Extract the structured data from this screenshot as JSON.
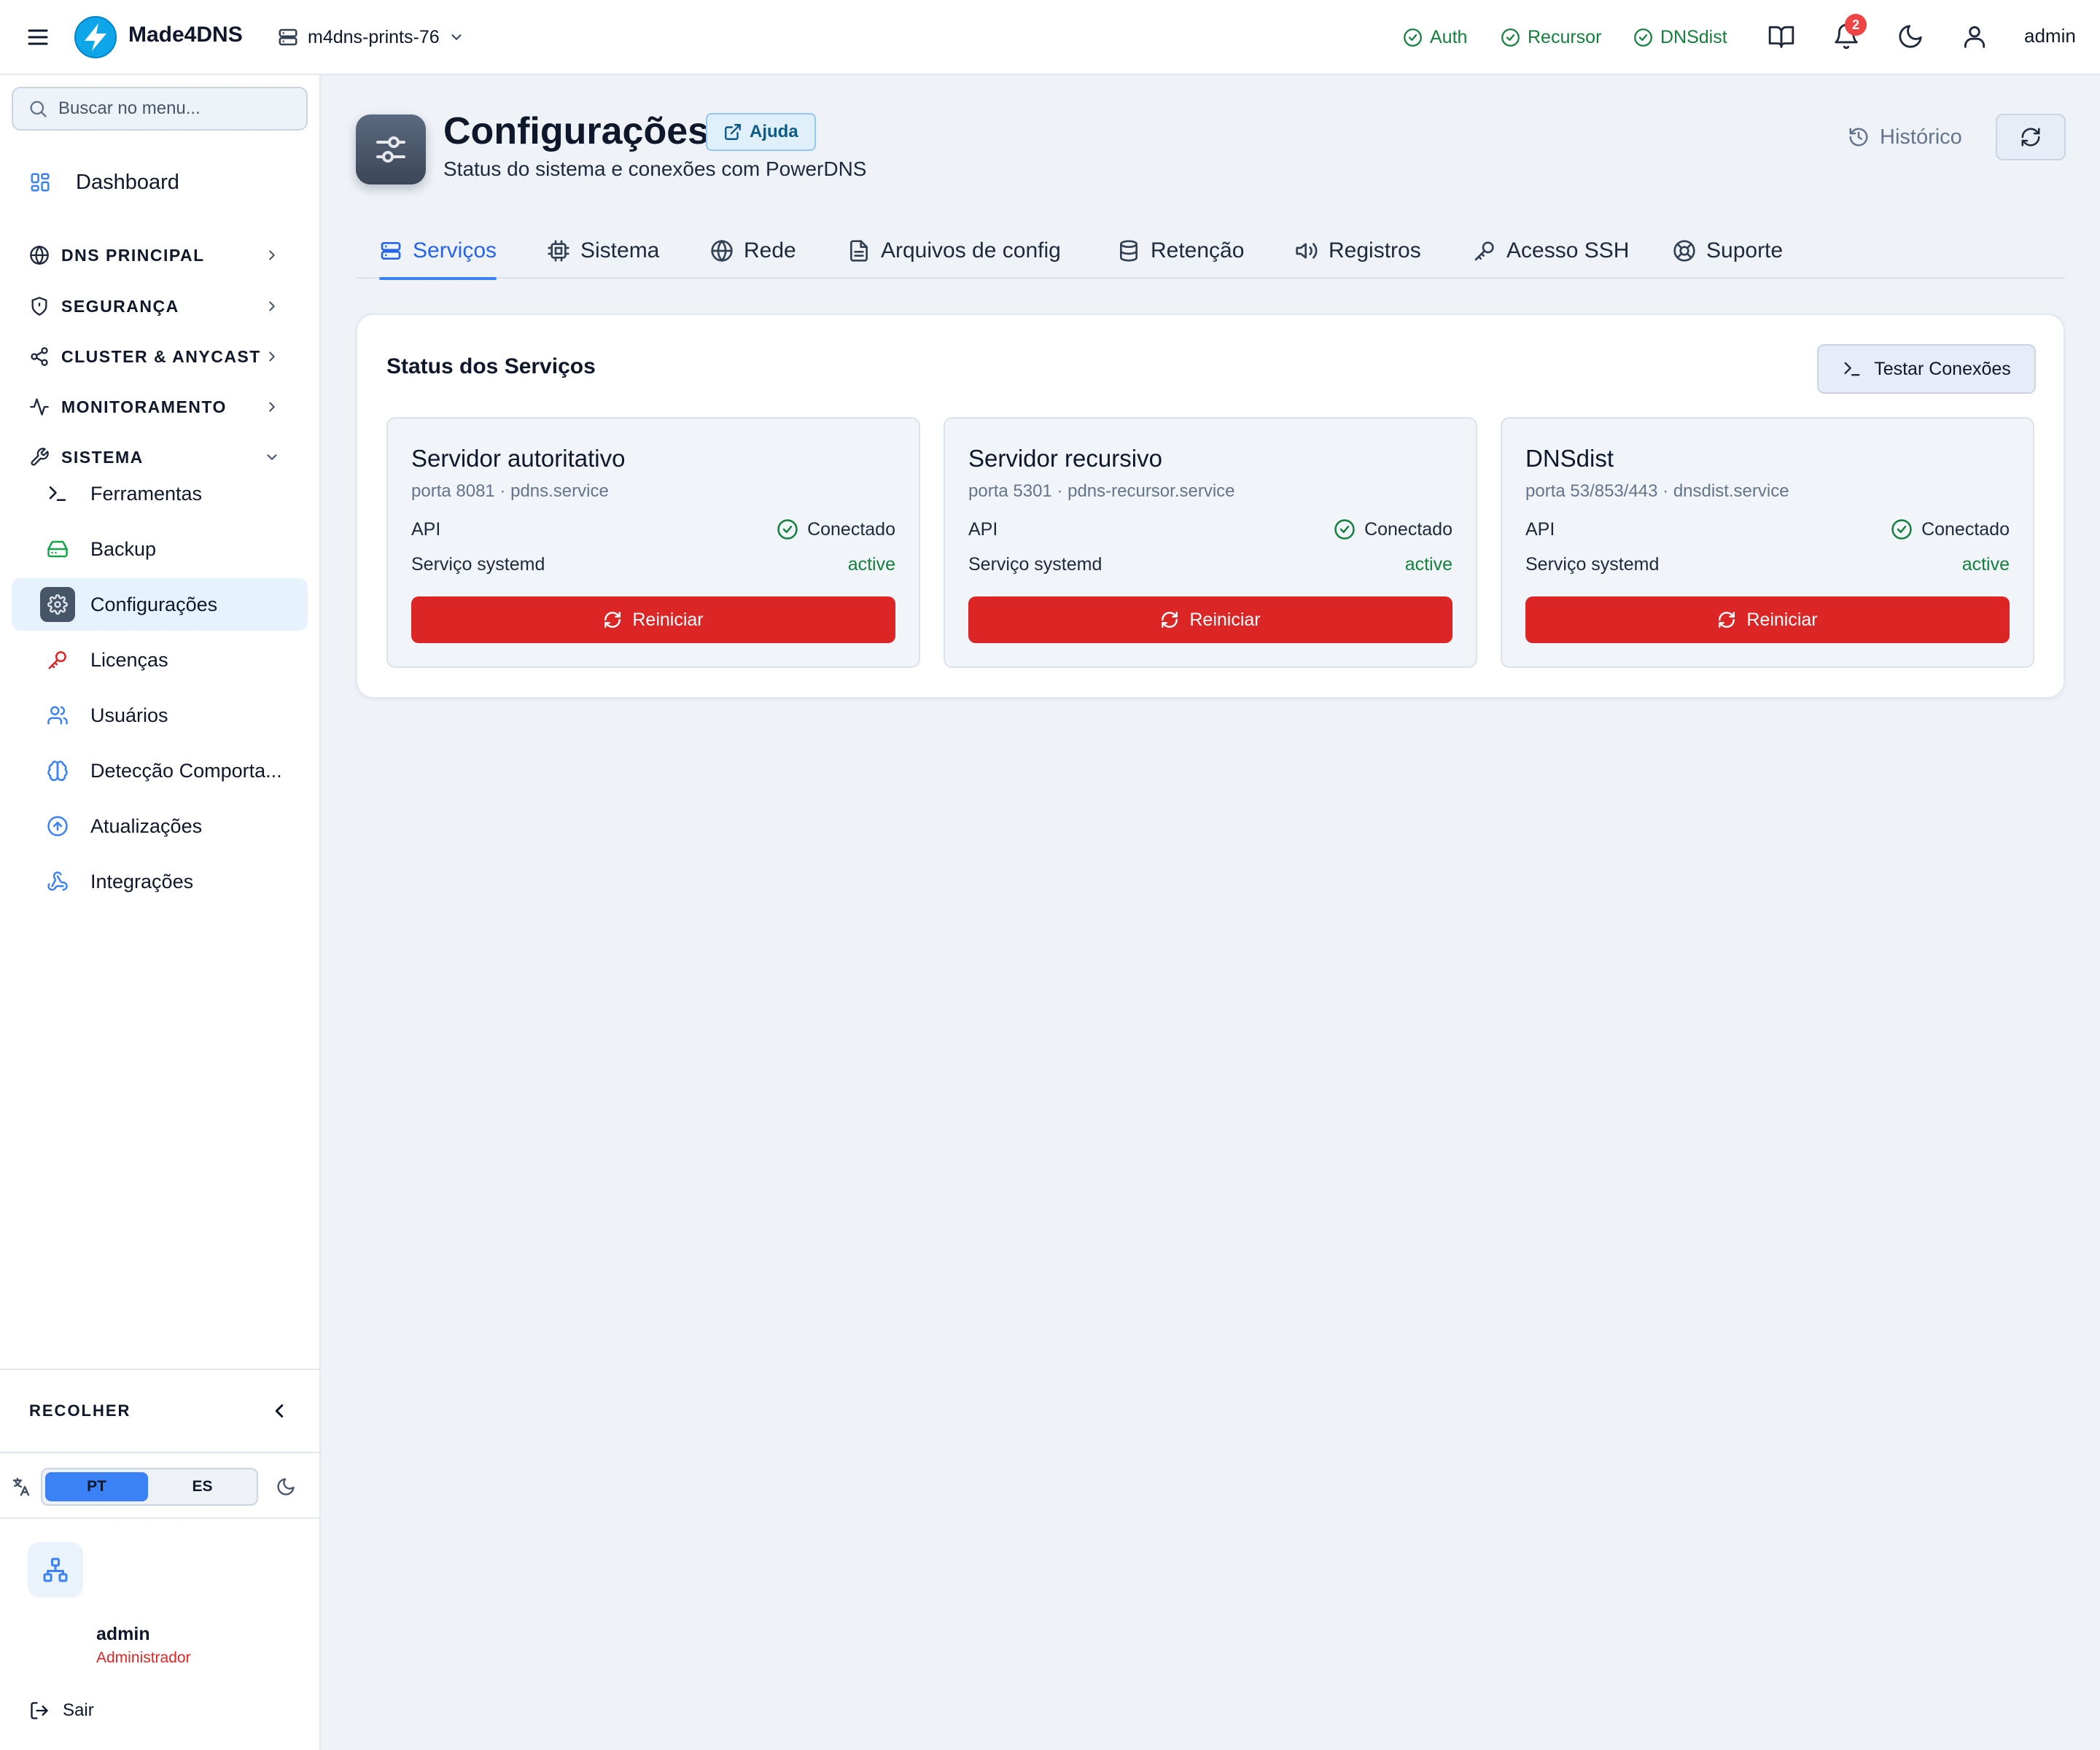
{
  "topbar": {
    "brand": "Made4DNS",
    "server": "m4dns-prints-76",
    "statuses": [
      {
        "label": "Auth",
        "icon": "check-circle-icon"
      },
      {
        "label": "Recursor",
        "icon": "check-circle-icon"
      },
      {
        "label": "DNSdist",
        "icon": "check-circle-icon"
      }
    ],
    "notification_count": "2",
    "user": "admin",
    "colors": {
      "ok": "#15803d",
      "badge": "#ef4444",
      "brand": "#0ea5e9"
    }
  },
  "sidebar": {
    "search_placeholder": "Buscar no menu...",
    "dashboard": "Dashboard",
    "sections": [
      {
        "label": "DNS PRINCIPAL",
        "icon": "globe-icon",
        "expanded": false
      },
      {
        "label": "SEGURANÇA",
        "icon": "shield-icon",
        "expanded": false
      },
      {
        "label": "CLUSTER & ANYCAST",
        "icon": "share-icon",
        "expanded": false
      },
      {
        "label": "MONITORAMENTO",
        "icon": "activity-icon",
        "expanded": false
      },
      {
        "label": "SISTEMA",
        "icon": "wrench-icon",
        "expanded": true
      }
    ],
    "sistema_items": [
      {
        "label": "Ferramentas",
        "icon": "terminal-icon",
        "color": "#0f172a"
      },
      {
        "label": "Backup",
        "icon": "hard-drive-icon",
        "color": "#16a34a"
      },
      {
        "label": "Configurações",
        "icon": "gear-icon",
        "active": true
      },
      {
        "label": "Licenças",
        "icon": "key-icon",
        "color": "#dc2626"
      },
      {
        "label": "Usuários",
        "icon": "users-icon",
        "color": "#3b82f6"
      },
      {
        "label": "Detecção Comporta...",
        "icon": "brain-icon",
        "color": "#3b82f6"
      },
      {
        "label": "Atualizações",
        "icon": "arrow-up-circle-icon",
        "color": "#3b82f6"
      },
      {
        "label": "Integrações",
        "icon": "webhook-icon",
        "color": "#3b82f6"
      }
    ],
    "collapse_label": "RECOLHER",
    "languages": [
      "PT",
      "ES"
    ],
    "selected_language": "PT",
    "profile": {
      "name": "admin",
      "role": "Administrador"
    },
    "logout": "Sair"
  },
  "page": {
    "title": "Configurações",
    "help": "Ajuda",
    "subtitle": "Status do sistema e conexões com PowerDNS",
    "history": "Histórico"
  },
  "tabs": [
    {
      "label": "Serviços",
      "icon": "server-icon",
      "active": true
    },
    {
      "label": "Sistema",
      "icon": "cpu-icon"
    },
    {
      "label": "Rede",
      "icon": "globe-icon"
    },
    {
      "label": "Arquivos de config",
      "icon": "file-icon"
    },
    {
      "label": "Retenção",
      "icon": "database-icon"
    },
    {
      "label": "Registros",
      "icon": "volume-icon"
    },
    {
      "label": "Acesso SSH",
      "icon": "key-icon"
    },
    {
      "label": "Suporte",
      "icon": "life-buoy-icon"
    }
  ],
  "services_panel": {
    "title": "Status dos Serviços",
    "test_button": "Testar Conexões",
    "cards": [
      {
        "name": "Servidor autoritativo",
        "meta": "porta 8081 · pdns.service",
        "api_label": "API",
        "api_status": "Conectado",
        "systemd_label": "Serviço systemd",
        "systemd_status": "active",
        "restart": "Reiniciar"
      },
      {
        "name": "Servidor recursivo",
        "meta": "porta 5301 · pdns-recursor.service",
        "api_label": "API",
        "api_status": "Conectado",
        "systemd_label": "Serviço systemd",
        "systemd_status": "active",
        "restart": "Reiniciar"
      },
      {
        "name": "DNSdist",
        "meta": "porta 53/853/443 · dnsdist.service",
        "api_label": "API",
        "api_status": "Conectado",
        "systemd_label": "Serviço systemd",
        "systemd_status": "active",
        "restart": "Reiniciar"
      }
    ]
  }
}
